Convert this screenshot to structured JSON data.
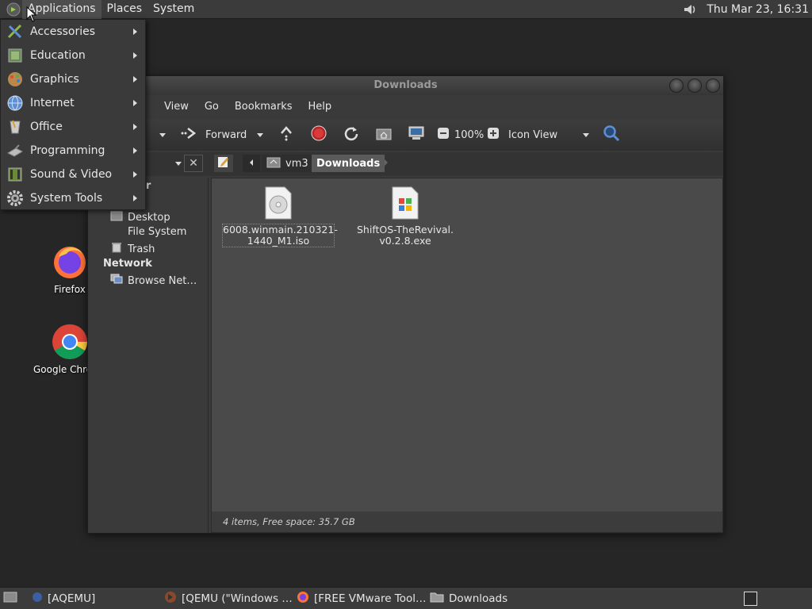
{
  "top_panel": {
    "menus": [
      "Applications",
      "Places",
      "System"
    ],
    "clock": "Thu Mar 23, 16:31"
  },
  "app_menu": {
    "items": [
      "Accessories",
      "Education",
      "Graphics",
      "Internet",
      "Office",
      "Programming",
      "Sound & Video",
      "System Tools"
    ]
  },
  "desktop": {
    "icons": [
      "Firefox",
      "Google Chrome"
    ]
  },
  "window": {
    "title": "Downloads",
    "menubar": [
      "View",
      "Go",
      "Bookmarks",
      "Help"
    ],
    "toolbar": {
      "forward_label": "Forward",
      "zoom_level": "100%",
      "view_mode": "Icon View"
    },
    "pathbar": {
      "crumbs": [
        "vm3",
        "Downloads"
      ]
    },
    "sidebar": {
      "partial_labels": [
        "er",
        "s"
      ],
      "places": [
        "Desktop",
        "File System",
        "Trash"
      ],
      "network_heading": "Network",
      "network_items": [
        "Browse Net…"
      ]
    },
    "files": [
      {
        "name_line1": "6008.winmain.210321-",
        "name_line2": "1440_M1.iso",
        "icon": "disc-image-icon"
      },
      {
        "name_line1": "ShiftOS-TheRevival.",
        "name_line2": "v0.2.8.exe",
        "icon": "executable-icon"
      }
    ],
    "status": "4 items, Free space: 35.7 GB"
  },
  "taskbar": {
    "tasks": [
      "[AQEMU]",
      "[QEMU (\"Windows …",
      "[FREE VMware Tool…",
      "Downloads"
    ]
  },
  "colors": {
    "panel_bg": "#3b3b3b",
    "desktop_bg": "#262626",
    "content_bg": "#4a4a4a",
    "selected_crumb": "#5a5a5a"
  }
}
